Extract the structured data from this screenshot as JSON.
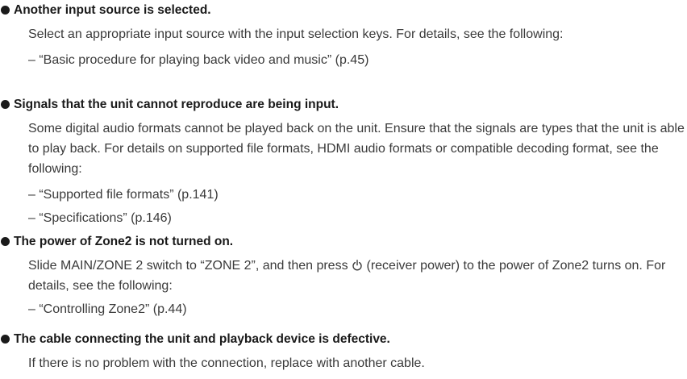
{
  "items": [
    {
      "heading": "Another input source is selected.",
      "text": "Select an appropriate input source with the input selection keys. For details, see the following:",
      "refs": [
        "– “Basic procedure for playing back video and music” (p.45)"
      ]
    },
    {
      "heading": "Signals that the unit cannot reproduce are being input.",
      "text": "Some digital audio formats cannot be played back on the unit. Ensure that the signals are types that the unit is able to play back. For details on supported file formats, HDMI audio formats or compatible decoding format, see the following:",
      "refs": [
        "– “Supported file formats” (p.141)",
        "– “Specifications” (p.146)"
      ]
    },
    {
      "heading": "The power of Zone2 is not turned on.",
      "text_before_icon": "Slide MAIN/ZONE 2 switch to “ZONE 2”, and then press",
      "icon": "power-icon",
      "text_after_icon": "(receiver power) to the power of Zone2 turns on. For details, see the following:",
      "refs": [
        "– “Controlling Zone2” (p.44)"
      ]
    },
    {
      "heading": "The cable connecting the unit and playback device is defective.",
      "text": "If there is no problem with the connection, replace with another cable."
    }
  ]
}
